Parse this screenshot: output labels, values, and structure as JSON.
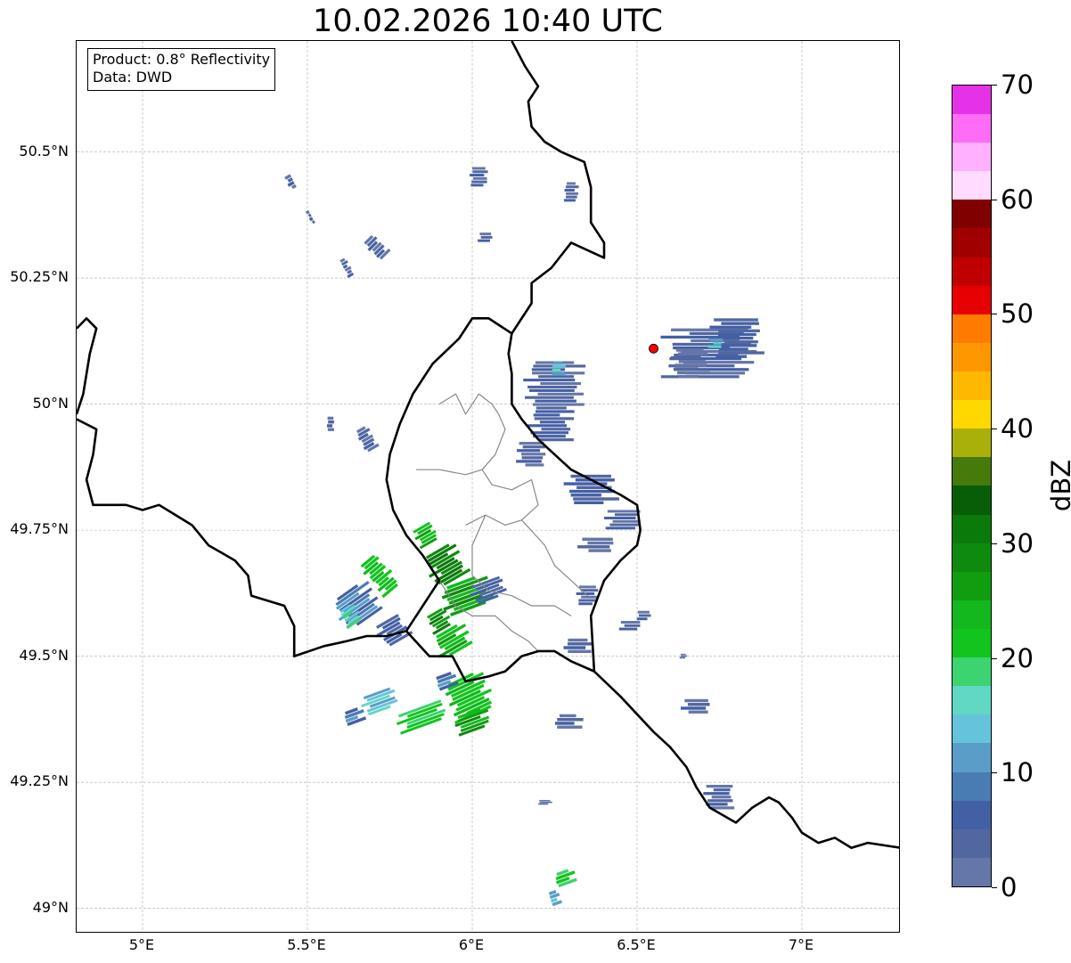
{
  "title": "10.02.2026 10:40 UTC",
  "info_box": {
    "product": "Product: 0.8° Reflectivity",
    "source": "Data: DWD"
  },
  "map": {
    "lon_range": [
      4.8,
      7.3
    ],
    "lat_range": [
      48.95,
      50.72
    ],
    "lat_ticks": [
      {
        "value": 50.5,
        "label": "50.5°N"
      },
      {
        "value": 50.25,
        "label": "50.25°N"
      },
      {
        "value": 50.0,
        "label": "50°N"
      },
      {
        "value": 49.75,
        "label": "49.75°N"
      },
      {
        "value": 49.5,
        "label": "49.5°N"
      },
      {
        "value": 49.25,
        "label": "49.25°N"
      },
      {
        "value": 49.0,
        "label": "49°N"
      }
    ],
    "lon_ticks": [
      {
        "value": 5.0,
        "label": "5°E"
      },
      {
        "value": 5.5,
        "label": "5.5°E"
      },
      {
        "value": 6.0,
        "label": "6°E"
      },
      {
        "value": 6.5,
        "label": "6.5°E"
      },
      {
        "value": 7.0,
        "label": "7°E"
      }
    ],
    "grid": true,
    "radar_site": {
      "lon": 6.55,
      "lat": 50.11,
      "color": "#ff0000"
    },
    "country_borders": [
      [
        [
          6.12,
          50.72
        ],
        [
          6.16,
          50.67
        ],
        [
          6.2,
          50.63
        ],
        [
          6.17,
          50.6
        ],
        [
          6.18,
          50.55
        ],
        [
          6.22,
          50.52
        ],
        [
          6.27,
          50.5
        ],
        [
          6.34,
          50.48
        ],
        [
          6.36,
          50.43
        ],
        [
          6.36,
          50.36
        ],
        [
          6.4,
          50.32
        ],
        [
          6.4,
          50.29
        ],
        [
          6.3,
          50.32
        ],
        [
          6.24,
          50.27
        ],
        [
          6.18,
          50.24
        ],
        [
          6.18,
          50.2
        ],
        [
          6.14,
          50.16
        ],
        [
          6.12,
          50.14
        ],
        [
          6.11,
          50.1
        ],
        [
          6.12,
          50.06
        ],
        [
          6.12,
          50.0
        ],
        [
          6.15,
          49.97
        ],
        [
          6.2,
          49.93
        ],
        [
          6.25,
          49.9
        ],
        [
          6.3,
          49.87
        ],
        [
          6.36,
          49.85
        ],
        [
          6.45,
          49.82
        ],
        [
          6.5,
          49.8
        ],
        [
          6.51,
          49.75
        ],
        [
          6.5,
          49.72
        ],
        [
          6.45,
          49.69
        ],
        [
          6.4,
          49.65
        ],
        [
          6.36,
          49.58
        ],
        [
          6.37,
          49.47
        ]
      ],
      [
        [
          6.37,
          49.47
        ],
        [
          6.45,
          49.42
        ],
        [
          6.55,
          49.35
        ],
        [
          6.6,
          49.32
        ],
        [
          6.65,
          49.28
        ],
        [
          6.68,
          49.24
        ],
        [
          6.72,
          49.2
        ],
        [
          6.8,
          49.17
        ],
        [
          6.85,
          49.2
        ],
        [
          6.9,
          49.22
        ],
        [
          6.93,
          49.21
        ],
        [
          6.97,
          49.18
        ],
        [
          7.0,
          49.15
        ],
        [
          7.05,
          49.13
        ],
        [
          7.1,
          49.14
        ],
        [
          7.15,
          49.12
        ],
        [
          7.2,
          49.13
        ],
        [
          7.3,
          49.12
        ]
      ],
      [
        [
          4.8,
          49.97
        ],
        [
          4.86,
          49.95
        ],
        [
          4.85,
          49.9
        ],
        [
          4.83,
          49.85
        ],
        [
          4.85,
          49.8
        ],
        [
          4.95,
          49.8
        ],
        [
          5.0,
          49.79
        ],
        [
          5.05,
          49.8
        ],
        [
          5.1,
          49.78
        ],
        [
          5.15,
          49.76
        ],
        [
          5.2,
          49.72
        ],
        [
          5.28,
          49.69
        ],
        [
          5.32,
          49.66
        ],
        [
          5.33,
          49.62
        ],
        [
          5.43,
          49.6
        ],
        [
          5.46,
          49.56
        ],
        [
          5.46,
          49.5
        ],
        [
          5.55,
          49.52
        ],
        [
          5.62,
          49.53
        ],
        [
          5.68,
          49.54
        ],
        [
          5.74,
          49.54
        ],
        [
          5.8,
          49.55
        ],
        [
          5.87,
          49.5
        ],
        [
          5.94,
          49.5
        ],
        [
          5.98,
          49.45
        ],
        [
          6.05,
          49.46
        ],
        [
          6.1,
          49.47
        ],
        [
          6.15,
          49.5
        ],
        [
          6.2,
          49.51
        ],
        [
          6.25,
          49.51
        ],
        [
          6.3,
          49.49
        ],
        [
          6.37,
          49.47
        ]
      ],
      [
        [
          5.8,
          49.55
        ],
        [
          5.85,
          49.6
        ],
        [
          5.9,
          49.65
        ],
        [
          5.85,
          49.7
        ],
        [
          5.8,
          49.74
        ],
        [
          5.76,
          49.79
        ],
        [
          5.74,
          49.85
        ],
        [
          5.75,
          49.9
        ],
        [
          5.78,
          49.96
        ],
        [
          5.82,
          50.02
        ],
        [
          5.88,
          50.08
        ],
        [
          5.96,
          50.13
        ],
        [
          6.0,
          50.17
        ],
        [
          6.05,
          50.17
        ],
        [
          6.12,
          50.14
        ]
      ],
      [
        [
          4.8,
          50.15
        ],
        [
          4.83,
          50.17
        ],
        [
          4.86,
          50.15
        ],
        [
          4.84,
          50.1
        ],
        [
          4.83,
          50.06
        ],
        [
          4.82,
          50.02
        ],
        [
          4.8,
          49.98
        ]
      ]
    ],
    "district_borders": [
      [
        [
          5.83,
          49.87
        ],
        [
          5.9,
          49.87
        ],
        [
          5.98,
          49.86
        ],
        [
          6.03,
          49.87
        ],
        [
          6.07,
          49.9
        ],
        [
          6.1,
          49.95
        ],
        [
          6.08,
          49.98
        ],
        [
          6.06,
          50.0
        ],
        [
          6.02,
          50.02
        ],
        [
          5.98,
          49.98
        ],
        [
          5.95,
          50.02
        ],
        [
          5.9,
          50.0
        ]
      ],
      [
        [
          6.03,
          49.87
        ],
        [
          6.06,
          49.84
        ],
        [
          6.12,
          49.83
        ],
        [
          6.18,
          49.85
        ],
        [
          6.2,
          49.8
        ],
        [
          6.15,
          49.77
        ],
        [
          6.1,
          49.76
        ],
        [
          6.04,
          49.78
        ],
        [
          5.98,
          49.76
        ]
      ],
      [
        [
          6.15,
          49.77
        ],
        [
          6.22,
          49.72
        ],
        [
          6.25,
          49.68
        ],
        [
          6.3,
          49.65
        ],
        [
          6.35,
          49.62
        ]
      ],
      [
        [
          6.04,
          49.78
        ],
        [
          6.0,
          49.72
        ],
        [
          6.0,
          49.66
        ],
        [
          6.05,
          49.63
        ],
        [
          6.12,
          49.62
        ],
        [
          6.18,
          49.6
        ],
        [
          6.25,
          49.6
        ],
        [
          6.3,
          49.58
        ]
      ],
      [
        [
          5.9,
          49.65
        ],
        [
          5.95,
          49.6
        ],
        [
          6.0,
          49.58
        ],
        [
          6.07,
          49.58
        ],
        [
          6.12,
          49.55
        ],
        [
          6.17,
          49.53
        ],
        [
          6.2,
          49.51
        ]
      ]
    ],
    "reflectivity_cells": [
      {
        "lon": 6.72,
        "lat": 50.1,
        "w": 0.24,
        "h": 0.1,
        "rot": 0,
        "dbz": 3
      },
      {
        "lon": 6.8,
        "lat": 50.13,
        "w": 0.14,
        "h": 0.08,
        "rot": 0,
        "dbz": 5
      },
      {
        "lon": 6.66,
        "lat": 50.08,
        "w": 0.1,
        "h": 0.06,
        "rot": 0,
        "dbz": 2
      },
      {
        "lon": 6.74,
        "lat": 50.12,
        "w": 0.04,
        "h": 0.02,
        "rot": 0,
        "dbz": 14
      },
      {
        "lon": 6.25,
        "lat": 50.04,
        "w": 0.16,
        "h": 0.09,
        "rot": 0,
        "dbz": 3
      },
      {
        "lon": 6.26,
        "lat": 50.07,
        "w": 0.04,
        "h": 0.03,
        "rot": 0,
        "dbz": 14
      },
      {
        "lon": 6.24,
        "lat": 49.96,
        "w": 0.12,
        "h": 0.07,
        "rot": 0,
        "dbz": 5
      },
      {
        "lon": 6.18,
        "lat": 49.9,
        "w": 0.08,
        "h": 0.05,
        "rot": 0,
        "dbz": 3
      },
      {
        "lon": 6.36,
        "lat": 49.83,
        "w": 0.14,
        "h": 0.06,
        "rot": 0,
        "dbz": 5
      },
      {
        "lon": 6.46,
        "lat": 49.77,
        "w": 0.1,
        "h": 0.04,
        "rot": 0,
        "dbz": 3
      },
      {
        "lon": 6.38,
        "lat": 49.72,
        "w": 0.1,
        "h": 0.03,
        "rot": 0,
        "dbz": 2
      },
      {
        "lon": 6.35,
        "lat": 49.62,
        "w": 0.06,
        "h": 0.04,
        "rot": 0,
        "dbz": 3
      },
      {
        "lon": 6.32,
        "lat": 49.52,
        "w": 0.08,
        "h": 0.03,
        "rot": 0,
        "dbz": 3
      },
      {
        "lon": 5.92,
        "lat": 49.68,
        "w": 0.1,
        "h": 0.07,
        "rot": -30,
        "dbz": 30
      },
      {
        "lon": 5.98,
        "lat": 49.62,
        "w": 0.14,
        "h": 0.06,
        "rot": -20,
        "dbz": 26
      },
      {
        "lon": 6.05,
        "lat": 49.63,
        "w": 0.1,
        "h": 0.04,
        "rot": -20,
        "dbz": 5
      },
      {
        "lon": 5.86,
        "lat": 49.74,
        "w": 0.06,
        "h": 0.04,
        "rot": -30,
        "dbz": 24
      },
      {
        "lon": 5.72,
        "lat": 49.66,
        "w": 0.06,
        "h": 0.08,
        "rot": -40,
        "dbz": 22
      },
      {
        "lon": 5.65,
        "lat": 49.6,
        "w": 0.12,
        "h": 0.07,
        "rot": -35,
        "dbz": 8
      },
      {
        "lon": 5.63,
        "lat": 49.58,
        "w": 0.05,
        "h": 0.04,
        "rot": -35,
        "dbz": 16
      },
      {
        "lon": 5.76,
        "lat": 49.55,
        "w": 0.08,
        "h": 0.05,
        "rot": -30,
        "dbz": 5
      },
      {
        "lon": 5.94,
        "lat": 49.53,
        "w": 0.1,
        "h": 0.05,
        "rot": -30,
        "dbz": 24
      },
      {
        "lon": 5.9,
        "lat": 49.57,
        "w": 0.06,
        "h": 0.04,
        "rot": -30,
        "dbz": 28
      },
      {
        "lon": 5.99,
        "lat": 49.42,
        "w": 0.12,
        "h": 0.08,
        "rot": -25,
        "dbz": 22
      },
      {
        "lon": 6.0,
        "lat": 49.37,
        "w": 0.1,
        "h": 0.04,
        "rot": -20,
        "dbz": 26
      },
      {
        "lon": 5.85,
        "lat": 49.38,
        "w": 0.14,
        "h": 0.04,
        "rot": -20,
        "dbz": 20
      },
      {
        "lon": 5.72,
        "lat": 49.41,
        "w": 0.1,
        "h": 0.04,
        "rot": -20,
        "dbz": 14
      },
      {
        "lon": 5.64,
        "lat": 49.38,
        "w": 0.06,
        "h": 0.03,
        "rot": -20,
        "dbz": 8
      },
      {
        "lon": 5.92,
        "lat": 49.45,
        "w": 0.06,
        "h": 0.03,
        "rot": -20,
        "dbz": 8
      },
      {
        "lon": 6.28,
        "lat": 49.06,
        "w": 0.06,
        "h": 0.03,
        "rot": -20,
        "dbz": 20
      },
      {
        "lon": 6.25,
        "lat": 49.02,
        "w": 0.03,
        "h": 0.03,
        "rot": -20,
        "dbz": 12
      },
      {
        "lon": 6.02,
        "lat": 50.45,
        "w": 0.05,
        "h": 0.04,
        "rot": 0,
        "dbz": 3
      },
      {
        "lon": 6.3,
        "lat": 50.42,
        "w": 0.04,
        "h": 0.04,
        "rot": 0,
        "dbz": 3
      },
      {
        "lon": 5.71,
        "lat": 50.31,
        "w": 0.04,
        "h": 0.05,
        "rot": -45,
        "dbz": 3
      },
      {
        "lon": 5.62,
        "lat": 50.27,
        "w": 0.02,
        "h": 0.04,
        "rot": -30,
        "dbz": 3
      },
      {
        "lon": 5.45,
        "lat": 50.44,
        "w": 0.02,
        "h": 0.03,
        "rot": -30,
        "dbz": 3
      },
      {
        "lon": 5.51,
        "lat": 50.37,
        "w": 0.01,
        "h": 0.03,
        "rot": -30,
        "dbz": 3
      },
      {
        "lon": 5.68,
        "lat": 49.93,
        "w": 0.04,
        "h": 0.05,
        "rot": -30,
        "dbz": 3
      },
      {
        "lon": 5.57,
        "lat": 49.96,
        "w": 0.02,
        "h": 0.03,
        "rot": 0,
        "dbz": 3
      },
      {
        "lon": 6.04,
        "lat": 50.33,
        "w": 0.04,
        "h": 0.02,
        "rot": 0,
        "dbz": 3
      },
      {
        "lon": 6.68,
        "lat": 49.4,
        "w": 0.08,
        "h": 0.03,
        "rot": 0,
        "dbz": 3
      },
      {
        "lon": 6.29,
        "lat": 49.37,
        "w": 0.08,
        "h": 0.03,
        "rot": 0,
        "dbz": 3
      },
      {
        "lon": 6.75,
        "lat": 49.22,
        "w": 0.08,
        "h": 0.05,
        "rot": 0,
        "dbz": 3
      },
      {
        "lon": 6.22,
        "lat": 49.21,
        "w": 0.04,
        "h": 0.01,
        "rot": 0,
        "dbz": 3
      },
      {
        "lon": 6.64,
        "lat": 49.5,
        "w": 0.02,
        "h": 0.01,
        "rot": 0,
        "dbz": 3
      },
      {
        "lon": 6.52,
        "lat": 49.58,
        "w": 0.04,
        "h": 0.02,
        "rot": 0,
        "dbz": 3
      },
      {
        "lon": 6.48,
        "lat": 49.56,
        "w": 0.06,
        "h": 0.02,
        "rot": 0,
        "dbz": 3
      }
    ]
  },
  "colorbar": {
    "label": "dBZ",
    "min": 0,
    "max": 70,
    "ticks": [
      {
        "value": 0,
        "label": "0"
      },
      {
        "value": 10,
        "label": "10"
      },
      {
        "value": 20,
        "label": "20"
      },
      {
        "value": 30,
        "label": "30"
      },
      {
        "value": 40,
        "label": "40"
      },
      {
        "value": 50,
        "label": "50"
      },
      {
        "value": 60,
        "label": "60"
      },
      {
        "value": 70,
        "label": "70"
      }
    ],
    "colors": [
      "#6576a8",
      "#5266a0",
      "#4460a4",
      "#4a7cb4",
      "#5a9dc8",
      "#66c3dc",
      "#60d8c4",
      "#3cd470",
      "#12c41e",
      "#12b81e",
      "#109e10",
      "#0e8a0e",
      "#0a7a0a",
      "#075e07",
      "#467a0a",
      "#aab00a",
      "#ffd800",
      "#ffb800",
      "#ff9800",
      "#ff7c00",
      "#e60000",
      "#c00000",
      "#a00000",
      "#800000",
      "#ffdcff",
      "#ffb0ff",
      "#ff6cf6",
      "#e632e6"
    ]
  }
}
